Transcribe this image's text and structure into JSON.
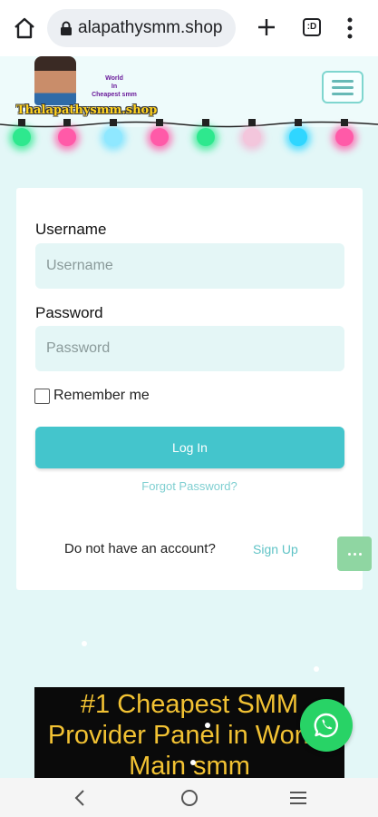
{
  "browser": {
    "url": "alapathysmm.shop",
    "tab_count": ":D"
  },
  "site": {
    "logo_text": "Thalapathysmm.shop",
    "logo_badge": [
      "World",
      "In",
      "Cheapest smm"
    ]
  },
  "login": {
    "username_label": "Username",
    "username_placeholder": "Username",
    "password_label": "Password",
    "password_placeholder": "Password",
    "remember_label": "Remember me",
    "login_button": "Log In",
    "forgot_link": "Forgot Password?",
    "no_account_text": "Do not have an account?",
    "signup_link": "Sign Up"
  },
  "banner": {
    "text": "#1 Cheapest SMM Provider Panel in World!    Main smm"
  },
  "colors": {
    "accent": "#44c5cc",
    "input_bg": "#e4f6f6",
    "page_bg": "#e3f7f7",
    "whatsapp": "#28d366",
    "banner_text": "#f2c233"
  }
}
